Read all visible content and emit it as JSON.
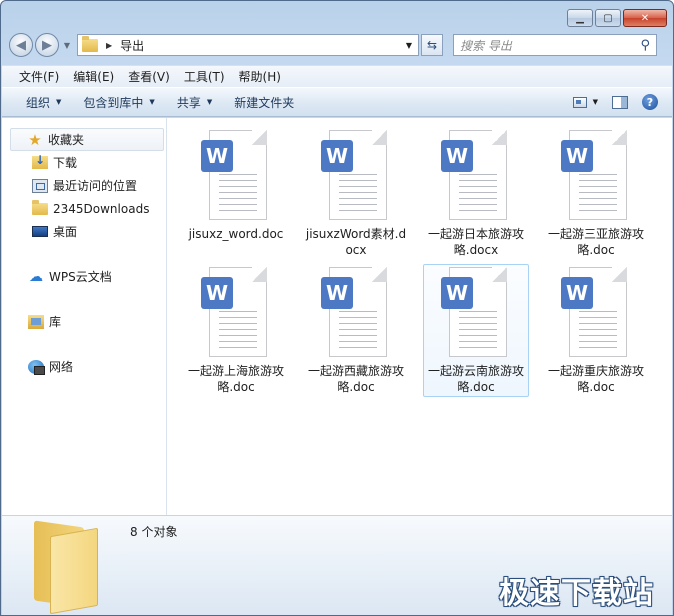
{
  "address": {
    "path_segment": "导出"
  },
  "search": {
    "placeholder": "搜索 导出"
  },
  "menu": [
    "文件(F)",
    "编辑(E)",
    "查看(V)",
    "工具(T)",
    "帮助(H)"
  ],
  "commands": {
    "organize": "组织",
    "include_library": "包含到库中",
    "share": "共享",
    "new_folder": "新建文件夹"
  },
  "nav": {
    "favorites": "收藏夹",
    "downloads": "下载",
    "recent": "最近访问的位置",
    "downloads2345": "2345Downloads",
    "desktop": "桌面",
    "wps_cloud": "WPS云文档",
    "libraries": "库",
    "network": "网络"
  },
  "files": [
    {
      "name": "jisuxz_word.doc",
      "badge": "W"
    },
    {
      "name": "jisuxzWord素材.docx",
      "badge": "W"
    },
    {
      "name": "一起游日本旅游攻略.docx",
      "badge": "W"
    },
    {
      "name": "一起游三亚旅游攻略.doc",
      "badge": "W"
    },
    {
      "name": "一起游上海旅游攻略.doc",
      "badge": "W"
    },
    {
      "name": "一起游西藏旅游攻略.doc",
      "badge": "W"
    },
    {
      "name": "一起游云南旅游攻略.doc",
      "badge": "W",
      "selected": true
    },
    {
      "name": "一起游重庆旅游攻略.doc",
      "badge": "W"
    }
  ],
  "details": {
    "count": "8 个对象"
  },
  "watermark": "极速下载站"
}
